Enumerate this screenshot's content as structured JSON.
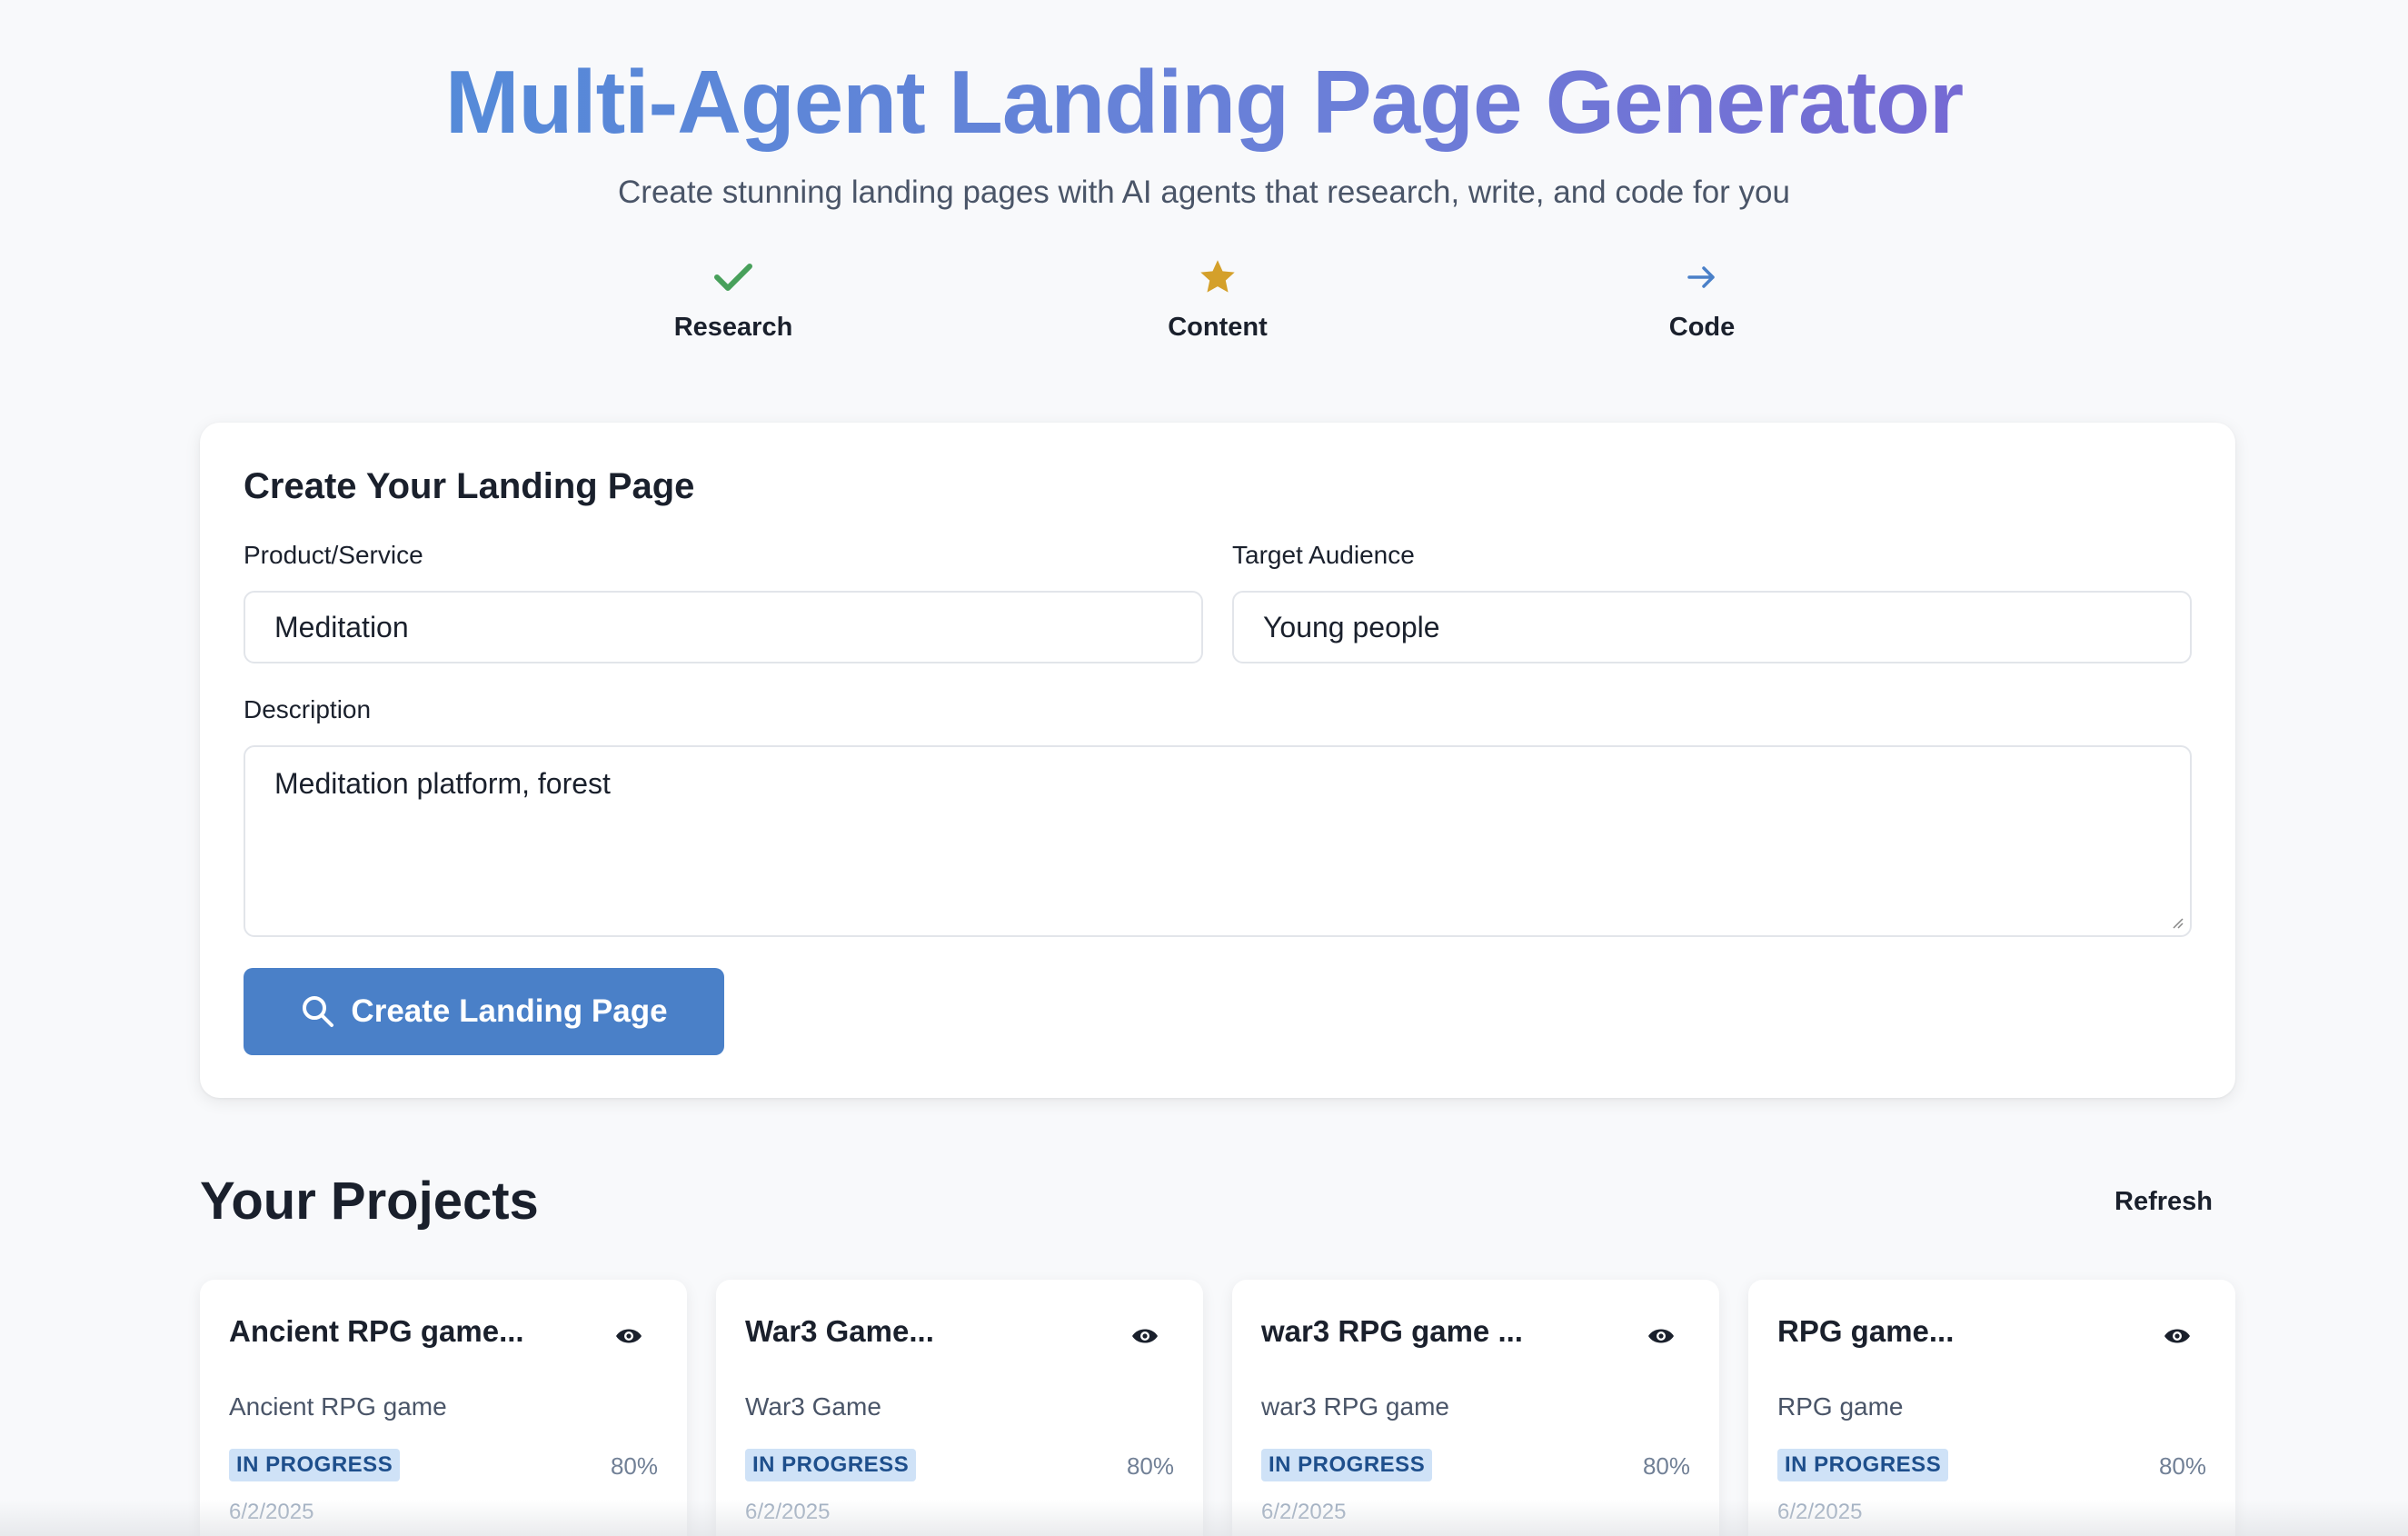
{
  "header": {
    "title": "Multi-Agent Landing Page Generator",
    "subtitle": "Create stunning landing pages with AI agents that research, write, and code for you"
  },
  "steps": [
    {
      "label": "Research",
      "icon": "check-icon",
      "color": "#48a05b"
    },
    {
      "label": "Content",
      "icon": "star-icon",
      "color": "#d4a02a"
    },
    {
      "label": "Code",
      "icon": "arrow-right-icon",
      "color": "#4a80c8"
    }
  ],
  "form": {
    "title": "Create Your Landing Page",
    "product_label": "Product/Service",
    "product_value": "Meditation",
    "audience_label": "Target Audience",
    "audience_value": "Young people",
    "description_label": "Description",
    "description_value": "Meditation platform, forest",
    "submit_label": "Create Landing Page"
  },
  "projects": {
    "title": "Your Projects",
    "refresh_label": "Refresh",
    "items": [
      {
        "title": "Ancient RPG game...",
        "description": "Ancient RPG game",
        "status": "IN PROGRESS",
        "progress": "80%",
        "date": "6/2/2025"
      },
      {
        "title": "War3 Game...",
        "description": "War3 Game",
        "status": "IN PROGRESS",
        "progress": "80%",
        "date": "6/2/2025"
      },
      {
        "title": "war3 RPG game ...",
        "description": "war3 RPG game",
        "status": "IN PROGRESS",
        "progress": "80%",
        "date": "6/2/2025"
      },
      {
        "title": "RPG game...",
        "description": "RPG game",
        "status": "IN PROGRESS",
        "progress": "80%",
        "date": "6/2/2025"
      }
    ]
  },
  "colors": {
    "accent": "#4a80c8",
    "badge_bg": "#cfe2f7",
    "badge_text": "#1e4f8c"
  }
}
